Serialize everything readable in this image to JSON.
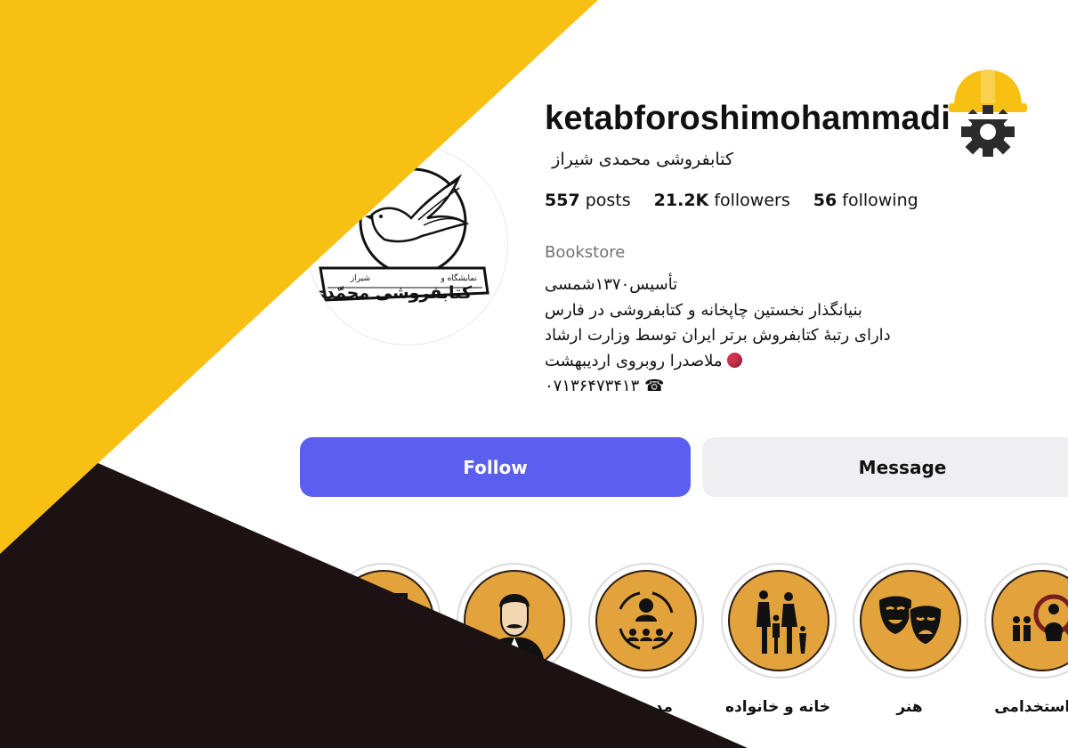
{
  "profile": {
    "username": "ketabforoshimohammadi",
    "full_name": "کتابفروشی محمدی شیراز",
    "stats": {
      "posts_count": "557",
      "posts_label": "posts",
      "followers_count": "21.2K",
      "followers_label": "followers",
      "following_count": "56",
      "following_label": "following"
    },
    "category": "Bookstore",
    "bio": [
      "تأسیس۱۳۷۰شمسی",
      "بنیانگذار نخستین چاپخانه و کتابفروشی در فارس",
      "دارای رتبهٔ کتابفروش برتر ایران توسط وزارت ارشاد",
      "ملاصدرا روبروی اردیبهشت",
      "☎ ۰۷۱۳۶۴۷۳۴۱۳"
    ],
    "avatar_text": {
      "top": "نمایشگاه و",
      "city": "شیراز",
      "name": "کتابفروشی محمّدی"
    }
  },
  "actions": {
    "follow_label": "Follow",
    "message_label": "Message"
  },
  "highlights": [
    {
      "label": "",
      "icon": "board-icon"
    },
    {
      "label": "",
      "icon": "portrait-icon"
    },
    {
      "label": "مدیریت",
      "icon": "management-icon"
    },
    {
      "label": "خانه و خانواده",
      "icon": "family-icon"
    },
    {
      "label": "هنر",
      "icon": "theater-masks-icon"
    },
    {
      "label": "ن استخدامی",
      "icon": "recruitment-icon"
    }
  ],
  "colors": {
    "accent_yellow": "#F9C014",
    "dark": "#1D1213",
    "follow_button": "#5B5FEF",
    "message_button": "#EFEFF1",
    "highlight_fill": "#E2A33D"
  }
}
